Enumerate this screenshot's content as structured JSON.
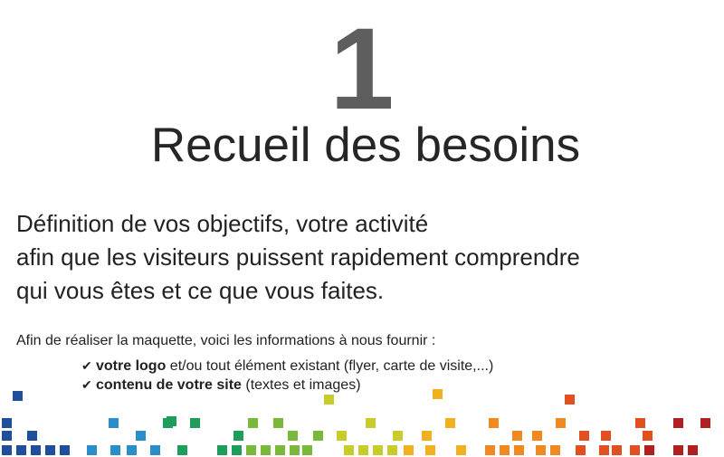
{
  "slide": {
    "step_number": "1",
    "title": "Recueil des besoins",
    "intro_lines": [
      "Définition de vos objectifs, votre activité",
      "afin que les visiteurs puissent rapidement comprendre",
      "qui vous êtes et ce que vous faites."
    ],
    "lead": "Afin de réaliser la maquette, voici les informations à nous fournir :",
    "checklist": [
      {
        "check": "✔",
        "bold": "votre logo",
        "rest": " et/ou tout élément existant (flyer, carte de visite,...)"
      },
      {
        "check": "✔",
        "bold": "contenu de votre site",
        "rest": " (textes et images)"
      }
    ]
  },
  "colors": {
    "number": "#5e5e5e",
    "text": "#222222",
    "mosaic_gradient": [
      "#1f4e9a",
      "#2a8fc8",
      "#1e9e5a",
      "#7ab83c",
      "#c8cc2a",
      "#f0b020",
      "#f08a20",
      "#e05020",
      "#b02020"
    ]
  }
}
